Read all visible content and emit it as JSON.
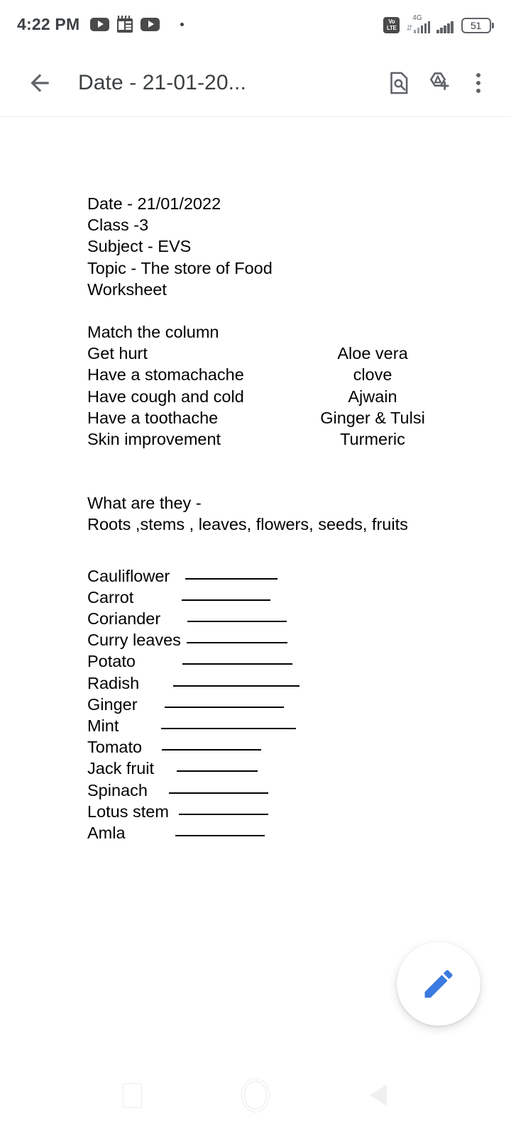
{
  "status_bar": {
    "time": "4:22 PM",
    "icons_left": [
      "youtube-icon",
      "notepad-icon",
      "youtube-icon",
      "dot-icon"
    ],
    "volte_top": "Vo",
    "volte_bottom": "LTE",
    "network_type": "4G",
    "battery_level": "51"
  },
  "app_bar": {
    "back_icon": "back-arrow-icon",
    "title": "Date - 21-01-20...",
    "find_icon": "document-search-icon",
    "add_icon": "add-shortcut-icon",
    "overflow_icon": "more-vert-icon"
  },
  "document": {
    "header_lines": [
      "Date - 21/01/2022",
      "Class -3",
      "Subject - EVS",
      "Topic - The store of Food",
      "Worksheet"
    ],
    "match_heading": "Match the column",
    "match_rows": [
      {
        "left": "Get hurt",
        "right": "Aloe vera"
      },
      {
        "left": "Have a stomachache",
        "right": "clove"
      },
      {
        "left": "Have cough and cold",
        "right": "Ajwain"
      },
      {
        "left": "Have a toothache",
        "right": "Ginger & Tulsi"
      },
      {
        "left": "Skin improvement",
        "right": "Turmeric"
      }
    ],
    "what_heading": "What are they -",
    "what_options": "Roots ,stems , leaves, flowers, seeds, fruits",
    "blank_rows": [
      {
        "name": "Cauliflower",
        "gap": 22,
        "rule": 130
      },
      {
        "name": "Carrot",
        "gap": 68,
        "rule": 125
      },
      {
        "name": "Coriander",
        "gap": 38,
        "rule": 140
      },
      {
        "name": "Curry leaves",
        "gap": 8,
        "rule": 142
      },
      {
        "name": "Potato",
        "gap": 66,
        "rule": 155
      },
      {
        "name": "Radish",
        "gap": 48,
        "rule": 178
      },
      {
        "name": "Ginger",
        "gap": 38,
        "rule": 168
      },
      {
        "name": "Mint",
        "gap": 60,
        "rule": 190
      },
      {
        "name": "Tomato",
        "gap": 28,
        "rule": 140
      },
      {
        "name": "Jack fruit",
        "gap": 32,
        "rule": 114
      },
      {
        "name": "Spinach",
        "gap": 30,
        "rule": 140
      },
      {
        "name": "Lotus stem",
        "gap": 14,
        "rule": 126
      },
      {
        "name": "Amla",
        "gap": 70,
        "rule": 126
      }
    ]
  },
  "fab": {
    "icon": "edit-pencil-icon",
    "color": "#3b7ae0"
  },
  "nav_bar": {
    "recents_icon": "square-recents-icon",
    "home_icon": "circle-home-icon",
    "back_icon": "triangle-back-icon"
  }
}
